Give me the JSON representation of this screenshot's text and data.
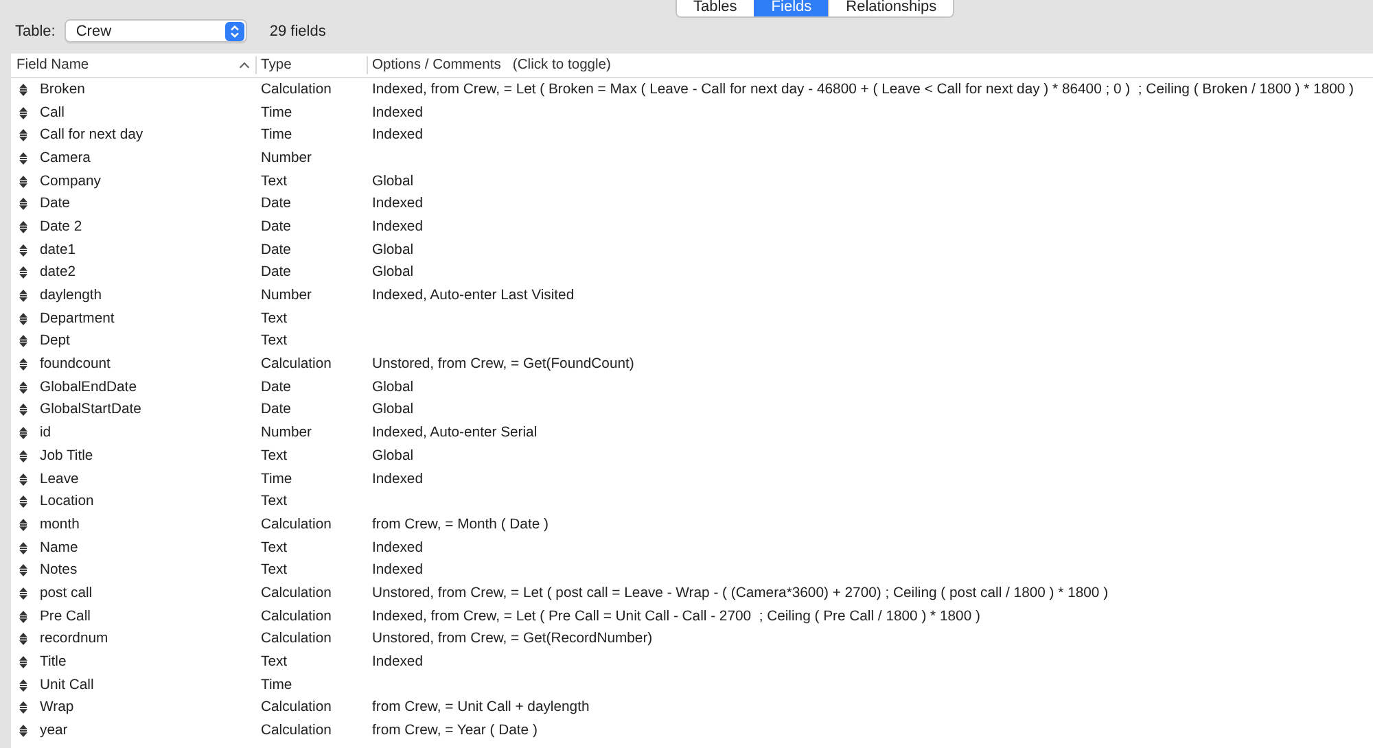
{
  "segmented_control": {
    "tabs": [
      {
        "label": "Tables",
        "selected": false
      },
      {
        "label": "Fields",
        "selected": true
      },
      {
        "label": "Relationships",
        "selected": false
      }
    ]
  },
  "table_picker": {
    "label": "Table:",
    "value": "Crew",
    "field_count": "29 fields"
  },
  "field_list": {
    "columns": [
      {
        "label": "Field Name",
        "sorted": true
      },
      {
        "label": "Type",
        "sorted": false
      },
      {
        "label": "Options / Comments   (Click to toggle)",
        "sorted": false
      }
    ],
    "rows": [
      {
        "name": "Broken",
        "type": "Calculation",
        "options": "Indexed, from Crew, = Let ( Broken = Max ( Leave - Call for next day - 46800 + ( Leave < Call for next day ) * 86400 ; 0 )  ; Ceiling ( Broken / 1800 ) * 1800 )"
      },
      {
        "name": "Call",
        "type": "Time",
        "options": "Indexed"
      },
      {
        "name": "Call for next day",
        "type": "Time",
        "options": "Indexed"
      },
      {
        "name": "Camera",
        "type": "Number"
      },
      {
        "name": "Company",
        "type": "Text",
        "options": "Global"
      },
      {
        "name": "Date",
        "type": "Date",
        "options": "Indexed"
      },
      {
        "name": "Date 2",
        "type": "Date",
        "options": "Indexed"
      },
      {
        "name": "date1",
        "type": "Date",
        "options": "Global"
      },
      {
        "name": "date2",
        "type": "Date",
        "options": "Global"
      },
      {
        "name": "daylength",
        "type": "Number",
        "options": "Indexed, Auto-enter Last Visited"
      },
      {
        "name": "Department",
        "type": "Text"
      },
      {
        "name": "Dept",
        "type": "Text"
      },
      {
        "name": "foundcount",
        "type": "Calculation",
        "options": "Unstored, from Crew, = Get(FoundCount)"
      },
      {
        "name": "GlobalEndDate",
        "type": "Date",
        "options": "Global"
      },
      {
        "name": "GlobalStartDate",
        "type": "Date",
        "options": "Global"
      },
      {
        "name": "id",
        "type": "Number",
        "options": "Indexed, Auto-enter Serial"
      },
      {
        "name": "Job Title",
        "type": "Text",
        "options": "Global"
      },
      {
        "name": "Leave",
        "type": "Time",
        "options": "Indexed"
      },
      {
        "name": "Location",
        "type": "Text"
      },
      {
        "name": "month",
        "type": "Calculation",
        "options": "from Crew, = Month ( Date )"
      },
      {
        "name": "Name",
        "type": "Text",
        "options": "Indexed"
      },
      {
        "name": "Notes",
        "type": "Text",
        "options": "Indexed"
      },
      {
        "name": "post call",
        "type": "Calculation",
        "options": "Unstored, from Crew, = Let ( post call = Leave - Wrap - ( (Camera*3600) + 2700) ; Ceiling ( post call / 1800 ) * 1800 )"
      },
      {
        "name": "Pre Call",
        "type": "Calculation",
        "options": "Indexed, from Crew, = Let ( Pre Call = Unit Call - Call - 2700  ; Ceiling ( Pre Call / 1800 ) * 1800 )"
      },
      {
        "name": "recordnum",
        "type": "Calculation",
        "options": "Unstored, from Crew, = Get(RecordNumber)"
      },
      {
        "name": "Title",
        "type": "Text",
        "options": "Indexed"
      },
      {
        "name": "Unit Call",
        "type": "Time"
      },
      {
        "name": "Wrap",
        "type": "Calculation",
        "options": "from Crew, = Unit Call + daylength"
      },
      {
        "name": "year",
        "type": "Calculation",
        "options": "from Crew, = Year ( Date )"
      }
    ]
  }
}
